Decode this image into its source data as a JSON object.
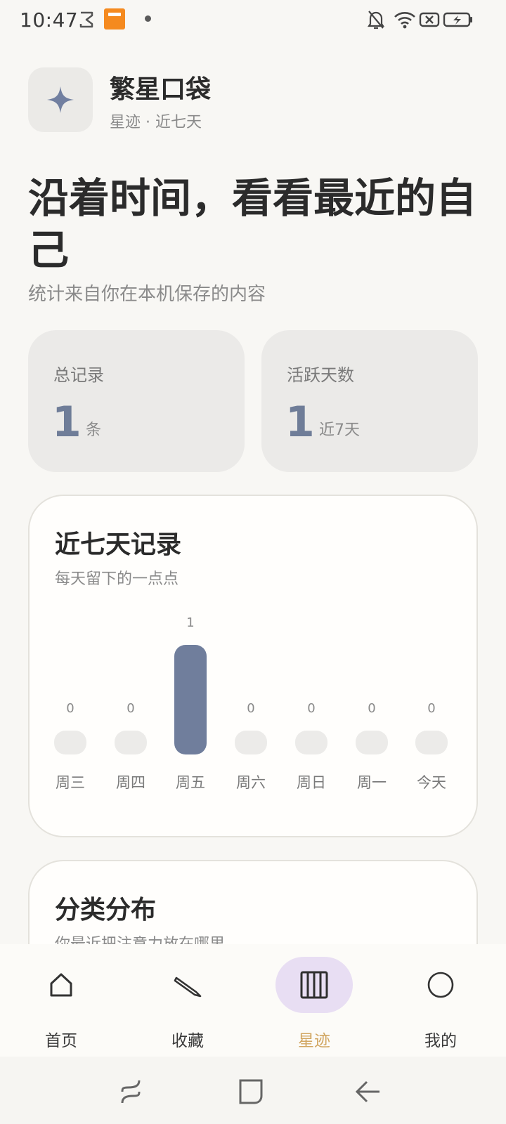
{
  "status_bar": {
    "time": "10:47",
    "icons": [
      "robot-icon",
      "app-notification-icon",
      "dot-icon",
      "bell-off-icon",
      "wifi-icon",
      "sim-off-icon",
      "battery-charging-icon"
    ]
  },
  "header": {
    "app_title": "繁星口袋",
    "subtitle": "星迹 · 近七天",
    "app_icon": "sparkle-icon",
    "accent_color": "#6f7d98"
  },
  "hero": {
    "headline": "沿着时间，看看最近的自己",
    "subline": "统计来自你在本机保存的内容"
  },
  "stats": [
    {
      "label": "总记录",
      "value": "1",
      "unit": "条"
    },
    {
      "label": "活跃天数",
      "value": "1",
      "unit": "近7天"
    }
  ],
  "week_card": {
    "title": "近七天记录",
    "subtitle": "每天留下的一点点",
    "days": [
      {
        "label": "周三",
        "count": "0"
      },
      {
        "label": "周四",
        "count": "0"
      },
      {
        "label": "周五",
        "count": "1"
      },
      {
        "label": "周六",
        "count": "0"
      },
      {
        "label": "周日",
        "count": "0"
      },
      {
        "label": "周一",
        "count": "0"
      },
      {
        "label": "今天",
        "count": "0"
      }
    ],
    "bar_color": "#707e9c",
    "empty_color": "#ecebe9"
  },
  "category_card": {
    "title": "分类分布",
    "subtitle": "你最近把注意力放在哪里"
  },
  "bottom_nav": {
    "items": [
      {
        "label": "首页",
        "icon": "home-icon"
      },
      {
        "label": "收藏",
        "icon": "pencil-icon"
      },
      {
        "label": "星迹",
        "icon": "columns-icon",
        "active": true
      },
      {
        "label": "我的",
        "icon": "profile-circle-icon"
      }
    ],
    "active_color": "#d1a661",
    "active_bg": "#e8def3"
  },
  "system_nav": [
    "recents-button",
    "home-button",
    "back-button"
  ]
}
